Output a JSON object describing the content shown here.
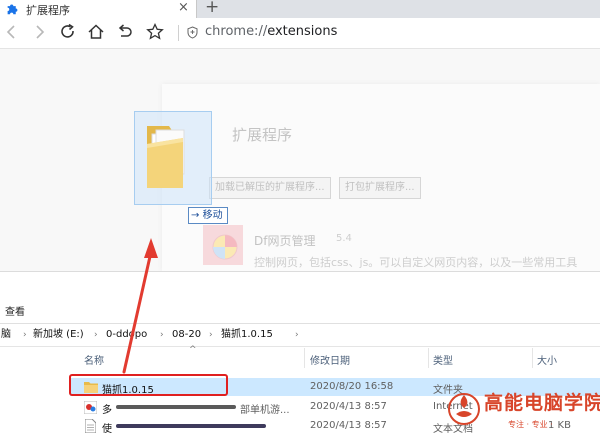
{
  "browser": {
    "tab_title": "扩展程序",
    "tab_close": "×",
    "new_tab": "+",
    "url_scheme": "chrome://",
    "url_path": "extensions"
  },
  "extensions_page": {
    "title": "扩展程序",
    "load_unpacked_label": "加载已解压的扩展程序...",
    "pack_label": "打包扩展程序...",
    "extension": {
      "name": "Df网页管理",
      "version": "5.4",
      "description": "控制网页，包括css、js。可以自定义网页内容，以及一些常用工具"
    }
  },
  "drag": {
    "tooltip": "移动",
    "tooltip_arrow": "→"
  },
  "explorer": {
    "ribbon_tab": "查看",
    "breadcrumbs": [
      "脑",
      "新加坡 (E:)",
      "0-ddopo",
      "08-20",
      "猫抓1.0.15"
    ],
    "columns": {
      "name": "名称",
      "date": "修改日期",
      "type": "类型",
      "size": "大小"
    },
    "sort_indicator": "^",
    "rows": [
      {
        "name": "猫抓1.0.15",
        "date": "2020/8/20 16:58",
        "type": "文件夹",
        "size": ""
      },
      {
        "name": "多",
        "name_tail": "部单机游...",
        "date": "2020/4/13 8:57",
        "type": "Internet",
        "size": ""
      },
      {
        "name": "使",
        "name_tail": "",
        "date": "2020/4/13 8:57",
        "type": "文本文档",
        "size": "1 KB"
      }
    ]
  },
  "watermark": {
    "title": "高能电脑学院",
    "subtitle": "专注 · 专业 ·"
  },
  "colors": {
    "accent": "#1a73e8",
    "highlight_red": "#e02020",
    "selection": "#cce8ff"
  }
}
